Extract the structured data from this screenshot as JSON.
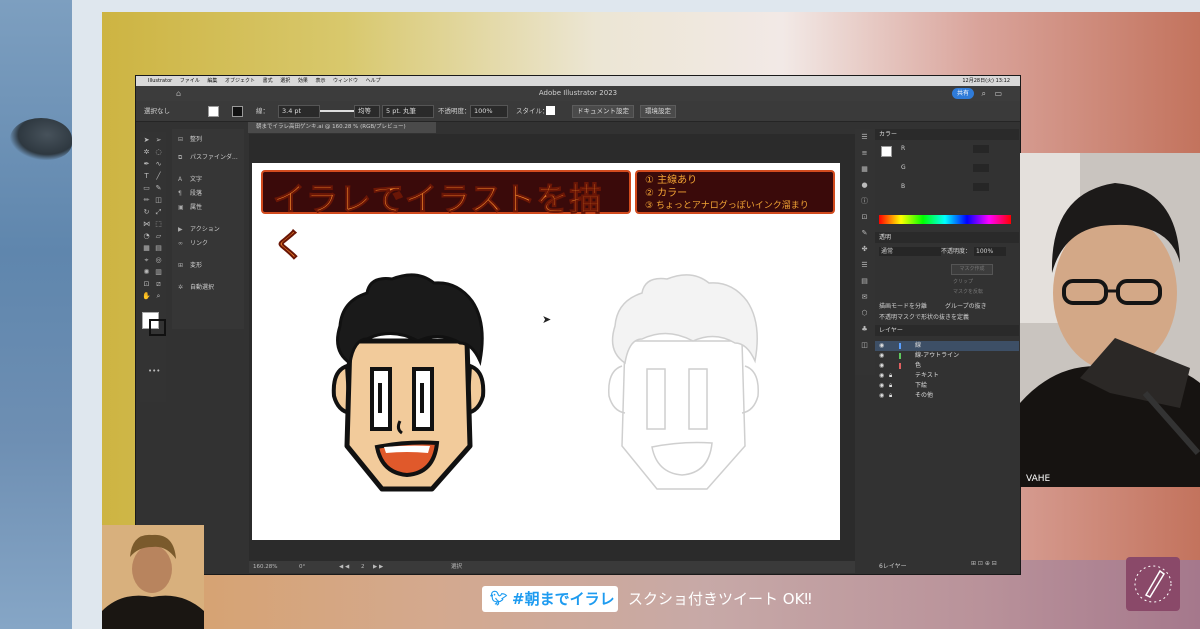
{
  "mac_menu": [
    "Illustrator",
    "ファイル",
    "編集",
    "オブジェクト",
    "書式",
    "選択",
    "効果",
    "表示",
    "ウィンドウ",
    "ヘルプ"
  ],
  "mac_status": "12月28日(火) 13:12",
  "window_title": "Adobe Illustrator 2023",
  "share_label": "共有",
  "control_bar": {
    "selection": "選択なし",
    "stroke_label": "線：",
    "stroke_weight": "3.4 pt",
    "profile": "均等",
    "brush": "5 pt. 丸筆",
    "opacity_label": "不透明度：",
    "opacity": "100%",
    "style_label": "スタイル：",
    "doc_setup": "ドキュメント設定",
    "preferences": "環境設定"
  },
  "doc_tab": "朝までイラレ高田ゲンキ.ai @ 160.28 % (RGB/プレビュー)",
  "left_panel": [
    {
      "icon": "align-icon",
      "label": "整列"
    },
    {
      "icon": "pathfinder-icon",
      "label": "パスファインダ..."
    },
    {
      "icon": "type-icon",
      "label": "文字"
    },
    {
      "icon": "paragraph-icon",
      "label": "段落"
    },
    {
      "icon": "attributes-icon",
      "label": "属性"
    },
    {
      "icon": "actions-icon",
      "label": "アクション"
    },
    {
      "icon": "links-icon",
      "label": "リンク"
    },
    {
      "icon": "transform-icon",
      "label": "変形"
    },
    {
      "icon": "auto-select-icon",
      "label": "自動選択"
    }
  ],
  "artboard": {
    "title": "イラレでイラストを描く",
    "points": [
      "① 主線あり",
      "② カラー",
      "③ ちょっとアナログっぽいインク溜まり"
    ]
  },
  "status_bar": {
    "zoom": "160.28%",
    "rotation": "0°",
    "artboard_num": "2",
    "tool": "選択"
  },
  "color_panel": {
    "title": "カラー",
    "channels": [
      "R",
      "G",
      "B"
    ]
  },
  "transparency_panel": {
    "title": "透明",
    "mode": "通常",
    "opacity_label": "不透明度：",
    "opacity": "100%",
    "mask_button": "マスク作成",
    "clip": "クリップ",
    "invert": "マスクを反転",
    "isolate": "描画モードを分離",
    "knockout": "グループの抜き",
    "define": "不透明マスクで形状の抜きを定義"
  },
  "layers_panel": {
    "title": "レイヤー",
    "layers": [
      {
        "name": "線",
        "color": "#5aa0ff"
      },
      {
        "name": "線-アウトライン",
        "color": "#5fc85f"
      },
      {
        "name": "色",
        "color": "#e06060"
      },
      {
        "name": "テキスト",
        "color": "#5aa0ff"
      },
      {
        "name": "下絵",
        "color": "#d49a2a"
      },
      {
        "name": "その他",
        "color": "#9a5ad4"
      }
    ],
    "count": "6レイヤー"
  },
  "twitter_tag": "#朝までイラレ",
  "twitter_note": "スクショ付きツイート OK‼",
  "mic_label": "VAHE"
}
